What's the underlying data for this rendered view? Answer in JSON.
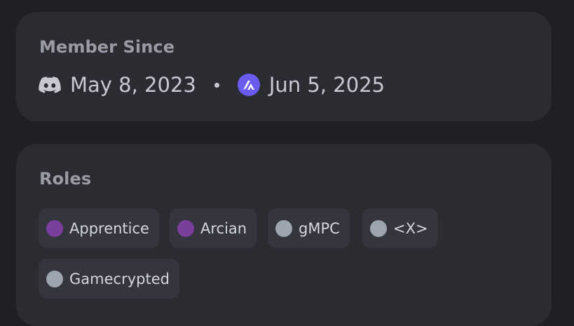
{
  "member_since": {
    "title": "Member Since",
    "discord_date": "May 8, 2023",
    "server_date": "Jun 5, 2025",
    "icons": [
      "discord-icon",
      "server-icon"
    ]
  },
  "roles": {
    "title": "Roles",
    "items": [
      {
        "name": "Apprentice",
        "color": "#7a3e9d"
      },
      {
        "name": "Arcian",
        "color": "#7a3e9d"
      },
      {
        "name": "gMPC",
        "color": "#9da6b0"
      },
      {
        "name": "<X>",
        "color": "#9da6b0"
      },
      {
        "name": "Gamecrypted",
        "color": "#9da6b0"
      }
    ]
  },
  "colors": {
    "background": "#1f1f24",
    "card": "#2b2b32",
    "chip": "#35353d",
    "server_icon": "#6b5cf0"
  }
}
